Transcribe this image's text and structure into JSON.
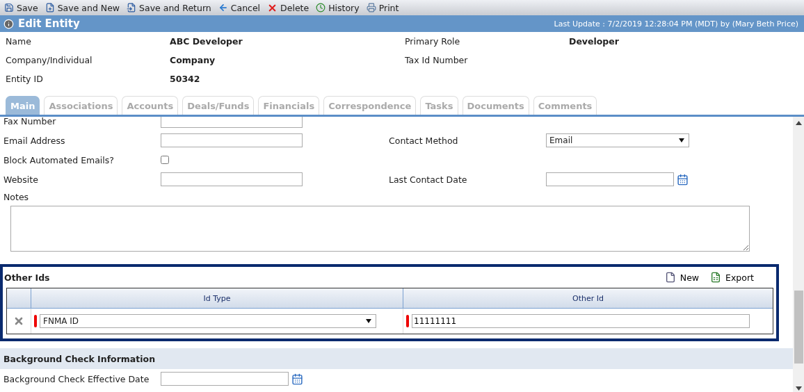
{
  "toolbar": [
    {
      "label": "Save"
    },
    {
      "label": "Save and New"
    },
    {
      "label": "Save and Return"
    },
    {
      "label": "Cancel"
    },
    {
      "label": "Delete"
    },
    {
      "label": "History"
    },
    {
      "label": "Print"
    }
  ],
  "header": {
    "title": "Edit Entity",
    "last_update": "Last Update : 7/2/2019 12:28:04 PM (MDT) by (Mary Beth Price)"
  },
  "summary": [
    {
      "label": "Name",
      "value": "ABC Developer",
      "label_2": "Primary Role",
      "value_2": "Developer"
    },
    {
      "label": "Company/Individual",
      "value": "Company",
      "label_2": "Tax Id Number"
    },
    {
      "label": "Entity ID",
      "value": "50342"
    }
  ],
  "tabs": [
    {
      "label": "Main",
      "selected": true
    },
    {
      "label": "Associations",
      "selected": false
    },
    {
      "label": "Accounts",
      "selected": false
    },
    {
      "label": "Deals/Funds",
      "selected": false
    },
    {
      "label": "Financials",
      "selected": false
    },
    {
      "label": "Correspondence",
      "selected": false
    },
    {
      "label": "Tasks",
      "selected": false
    },
    {
      "label": "Documents",
      "selected": false
    },
    {
      "label": "Comments",
      "selected": false
    }
  ],
  "form": [
    {
      "label": "Fax Number",
      "kind": "text"
    },
    {
      "label": "Email Address",
      "kind": "text",
      "right": {
        "label": "Contact Method",
        "kind": "select",
        "value": "Email"
      }
    },
    {
      "label": "Block Automated Emails?",
      "kind": "checkbox",
      "checked": false
    },
    {
      "label": "Website",
      "kind": "text",
      "right": {
        "label": "Last Contact Date",
        "kind": "date"
      }
    }
  ],
  "notes": {
    "label": "Notes"
  },
  "other_ids": {
    "title": "Other Ids",
    "actions": [
      {
        "label": "New"
      },
      {
        "label": "Export"
      }
    ],
    "columns": [
      "Id Type",
      "Other Id"
    ],
    "rows": [
      {
        "id_type": "FNMA ID",
        "other_id": "11111111"
      }
    ]
  },
  "background_check": {
    "title": "Background Check Information",
    "fields": [
      {
        "label": "Background Check Effective Date",
        "kind": "date"
      }
    ]
  }
}
